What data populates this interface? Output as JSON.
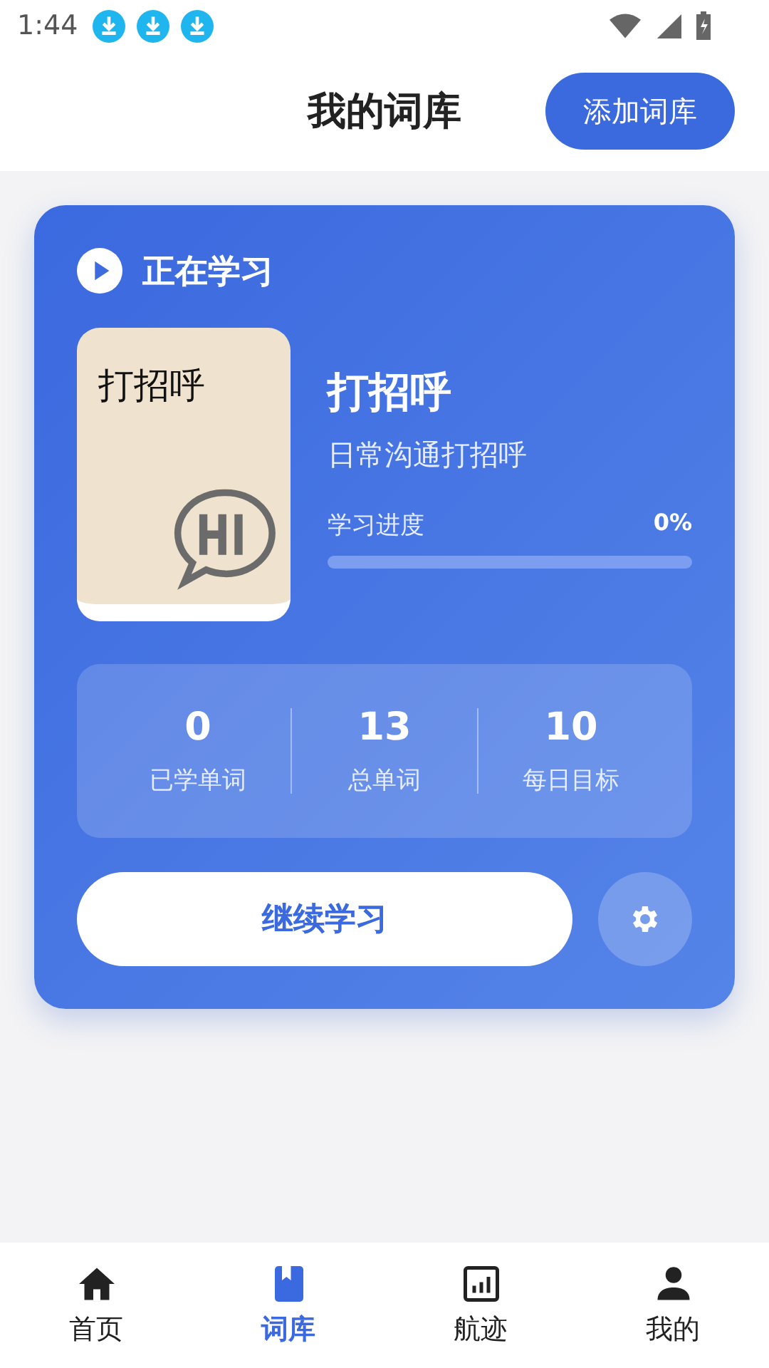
{
  "status_bar": {
    "time": "1:44",
    "notifications": [
      {
        "kind": "download"
      },
      {
        "kind": "download"
      },
      {
        "kind": "download"
      }
    ]
  },
  "header": {
    "title": "我的词库",
    "add_button": "添加词库"
  },
  "current": {
    "heading": "正在学习",
    "cover_title": "打招呼",
    "name": "打招呼",
    "description": "日常沟通打招呼",
    "progress_label": "学习进度",
    "progress_value": "0%",
    "level": 0,
    "stats": [
      {
        "value": "0",
        "label": "已学单词"
      },
      {
        "value": "13",
        "label": "总单词"
      },
      {
        "value": "10",
        "label": "每日目标"
      }
    ],
    "continue_button": "继续学习"
  },
  "tabs": [
    {
      "label": "首页",
      "kind": "home",
      "selected": false
    },
    {
      "label": "词库",
      "kind": "book",
      "selected": true
    },
    {
      "label": "航迹",
      "kind": "chart",
      "selected": false
    },
    {
      "label": "我的",
      "kind": "person",
      "selected": false
    }
  ]
}
